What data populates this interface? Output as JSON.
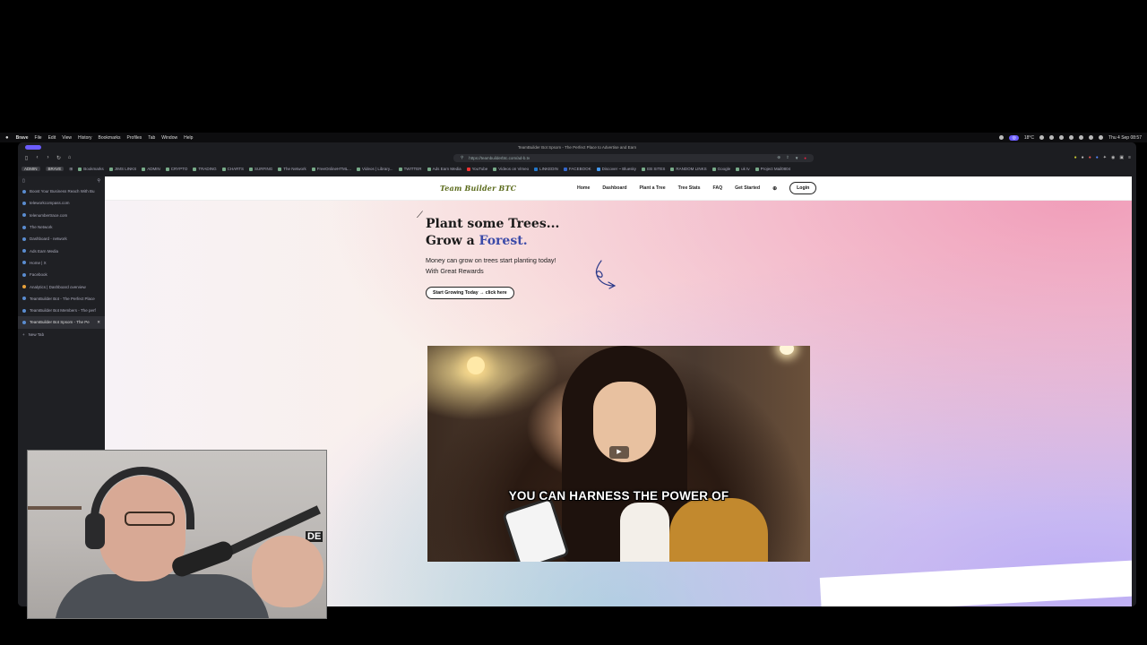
{
  "menubar": {
    "app": "Brave",
    "items": [
      "File",
      "Edit",
      "View",
      "History",
      "Bookmarks",
      "Profiles",
      "Tab",
      "Window",
      "Help"
    ],
    "weather": "18°C",
    "clock": "Thu 4 Sep 08:57"
  },
  "window": {
    "title": "TeamBuilder Bot Spsom - The Perfect Place to Advertise and Earn"
  },
  "nav": {
    "url": "https://teambuilderbtc.com/ad-b.tv"
  },
  "bookmarks": {
    "workspaces": [
      "ADMIN",
      "BRAVE"
    ],
    "items": [
      "Bookmarks",
      "JIMS LINKS",
      "ADMIN",
      "CRYPTO",
      "TRADING",
      "CHARTS",
      "SURFING",
      "The Network",
      "FreeOnlineHTML...",
      "Videos | Library...",
      "TWITTER",
      "Ads Earn Media",
      "YouTube",
      "Videos on Vimeo",
      "LINKEDIN",
      "FACEBOOK",
      "Discover ~ Bluesky",
      "EB SITES",
      "RANDOM LINKS",
      "Google",
      "uk tv",
      "Project Mail0804"
    ]
  },
  "sidebar": {
    "tabs": [
      "Boost Your Business Reach With Bu",
      "teleworkcompass.com",
      "telenumbertrace.com",
      "The Network",
      "Dashboard - network",
      "Ads Earn Media",
      "Home | X",
      "Facebook",
      "Analytics | Dashboard overview",
      "TeamBuilder Bot - The Perfect Place",
      "TeamBuilder Bot Members - The perf",
      "TeamBuilder Bot Spsom - The Pe"
    ],
    "new_tab": "New Tab"
  },
  "site": {
    "logo": "Team Builder BTC",
    "links": [
      "Home",
      "Dashboard",
      "Plant a Tree",
      "Tree Stats",
      "FAQ",
      "Get Started"
    ],
    "login": "Login",
    "hero": {
      "line1": "Plant some Trees...",
      "line2_prefix": "Grow a ",
      "line2_highlight": "Forest.",
      "tagline1": "Money can grow on trees start planting today!",
      "tagline2": "With Great Rewards",
      "cta": "Start Growing Today → click here"
    },
    "video": {
      "caption": "YOU CAN HARNESS THE POWER OF"
    }
  },
  "webcam": {
    "sign_text": "DE"
  },
  "colors": {
    "accent": "#3b4aa8",
    "logo": "#5a6a1a",
    "workspace_pill": "#6b5cff"
  }
}
